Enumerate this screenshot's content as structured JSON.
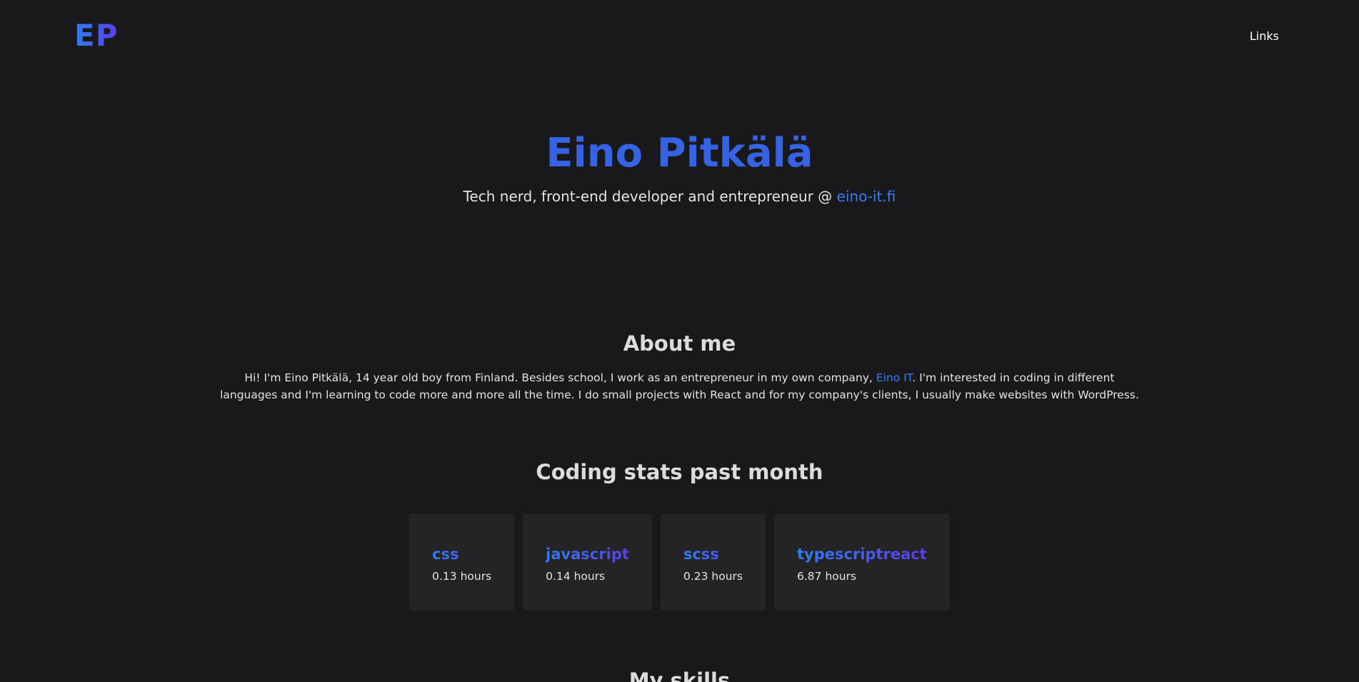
{
  "header": {
    "logo": "EP",
    "nav_links_label": "Links"
  },
  "hero": {
    "name": "Eino Pitkälä",
    "subtitle_prefix": "Tech nerd, front-end developer and entrepreneur @ ",
    "subtitle_link": "eino-it.fi"
  },
  "about": {
    "title": "About me",
    "text_before_link": "Hi! I'm Eino Pitkälä, 14 year old boy from Finland. Besides school, I work as an entrepreneur in my own company, ",
    "link_text": "Eino IT",
    "text_after_link": ". I'm interested in coding in different languages and I'm learning to code more and more all the time. I do small projects with React and for my company's clients, I usually make websites with WordPress."
  },
  "stats": {
    "title": "Coding stats past month",
    "items": [
      {
        "language": "css",
        "hours": "0.13 hours"
      },
      {
        "language": "javascript",
        "hours": "0.14 hours"
      },
      {
        "language": "scss",
        "hours": "0.23 hours"
      },
      {
        "language": "typescriptreact",
        "hours": "6.87 hours"
      }
    ]
  },
  "skills": {
    "title": "My skills"
  },
  "colors": {
    "background": "#19191c",
    "accent_blue": "#3563e4",
    "link_blue": "#3b7df2",
    "gradient_start": "#2f7df0",
    "gradient_end": "#5a3ee8",
    "card_background": "#242426"
  }
}
